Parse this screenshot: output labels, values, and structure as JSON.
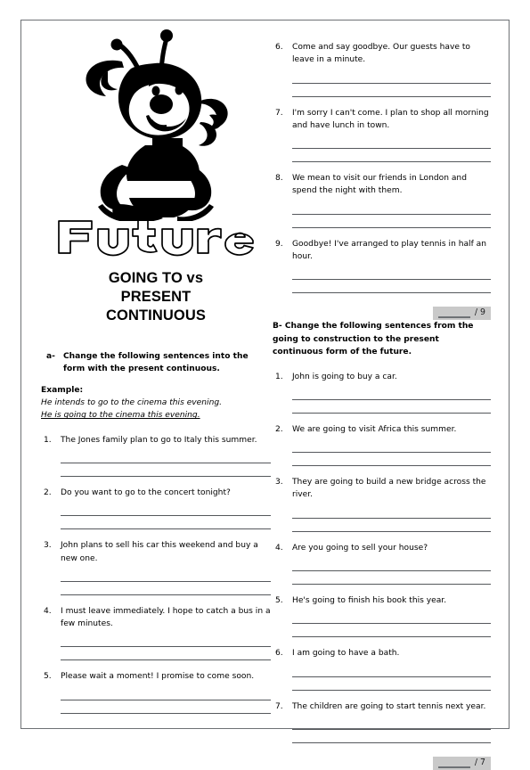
{
  "worksheet": {
    "logo_word": "Future",
    "logo_icon": "cartoon-bee",
    "title_lines": [
      "GOING TO vs",
      "PRESENT",
      "CONTINUOUS"
    ]
  },
  "part_a": {
    "marker": "a-",
    "instruction": "Change the following sentences into the form with the present continuous.",
    "example_label": "Example:",
    "example_prompt": "He intends to go to the cinema this evening.",
    "example_answer": "He is going to the cinema this evening.",
    "items": [
      {
        "num": "1.",
        "text": "The Jones family plan to go to Italy this summer."
      },
      {
        "num": "2.",
        "text": "Do you want to go to the concert tonight?"
      },
      {
        "num": "3.",
        "text": "John plans to sell his car this weekend and buy a new one."
      },
      {
        "num": "4.",
        "text": "I must leave immediately. I hope to catch a bus in a few minutes."
      },
      {
        "num": "5.",
        "text": "Please wait a moment! I promise to come soon."
      },
      {
        "num": "6.",
        "text": "Come and say goodbye. Our guests have to leave in a minute."
      },
      {
        "num": "7.",
        "text": "I'm sorry I can't come. I plan to shop all morning and have lunch in town."
      },
      {
        "num": "8.",
        "text": "We mean to visit our friends in London and spend the night with them."
      },
      {
        "num": "9.",
        "text": "Goodbye! I've arranged to play tennis in half an hour."
      }
    ],
    "score_separator": "/ 9"
  },
  "part_b": {
    "instruction": "B- Change the following sentences from the going to construction to the present continuous form of the future.",
    "items": [
      {
        "num": "1.",
        "text": "John is going to buy a car."
      },
      {
        "num": "2.",
        "text": "We are going to visit Africa this summer."
      },
      {
        "num": "3.",
        "text": "They are going to build a new bridge across the river."
      },
      {
        "num": "4.",
        "text": "Are you going to sell your house?"
      },
      {
        "num": "5.",
        "text": "He's going to finish his book this year."
      },
      {
        "num": "6.",
        "text": "I am going to have a bath."
      },
      {
        "num": "7.",
        "text": "The children are going to start tennis next year."
      }
    ],
    "score_separator": "/ 7"
  }
}
